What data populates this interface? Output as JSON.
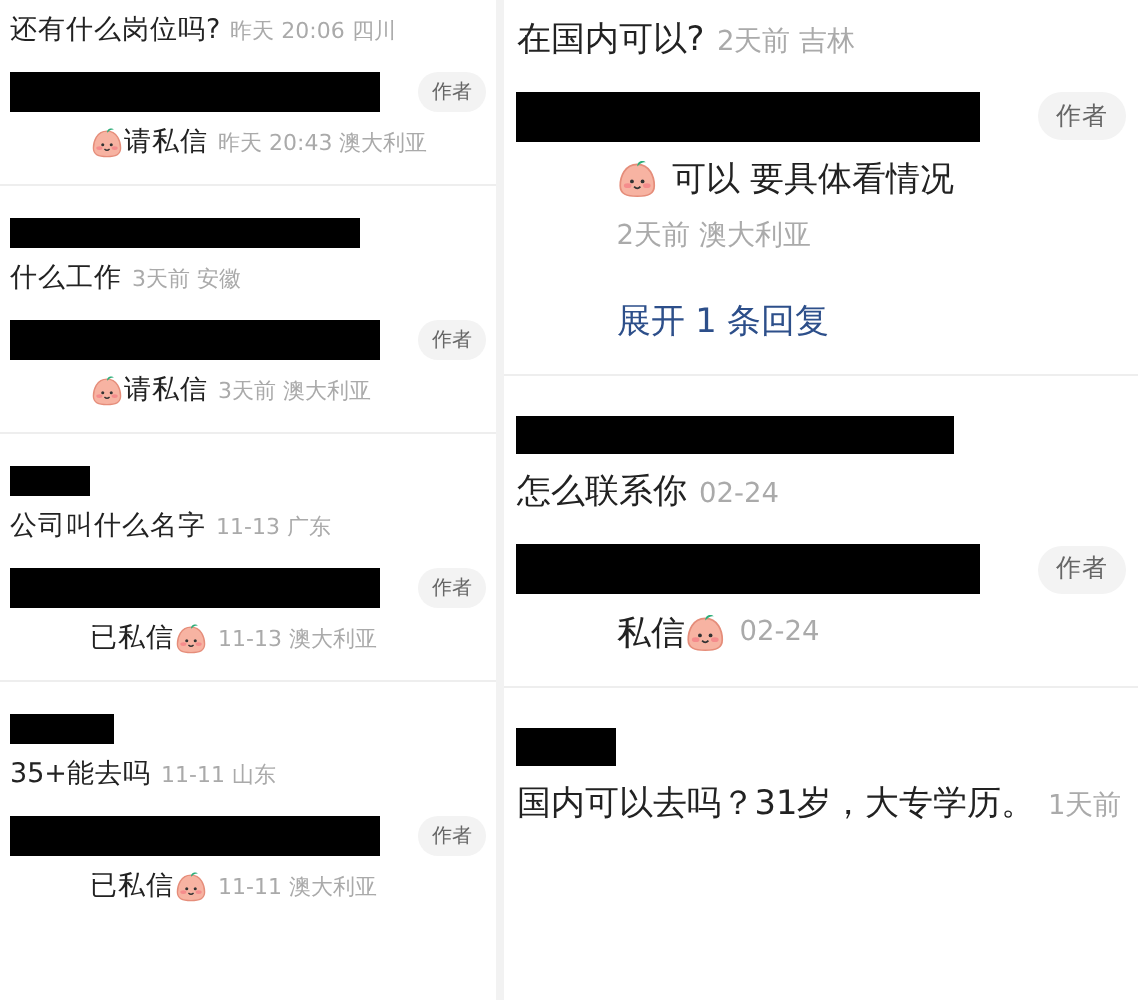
{
  "left_panel": {
    "threads": [
      {
        "comment": {
          "name_redacted": false,
          "text": "还有什么岗位吗?",
          "meta": "昨天 20:06 四川"
        },
        "reply": {
          "badge": "作者",
          "lines": [
            [
              {
                "kind": "emoji"
              },
              {
                "kind": "text",
                "text": "请私信"
              },
              {
                "kind": "meta",
                "text": "昨天 20:43 澳大利亚"
              }
            ]
          ]
        }
      },
      {
        "comment": {
          "name_redacted": true,
          "text": "什么工作",
          "meta": "3天前 安徽"
        },
        "reply": {
          "badge": "作者",
          "lines": [
            [
              {
                "kind": "emoji"
              },
              {
                "kind": "text",
                "text": "请私信"
              },
              {
                "kind": "meta",
                "text": "3天前 澳大利亚"
              }
            ]
          ]
        }
      },
      {
        "comment": {
          "name_redacted": true,
          "text": "公司叫什么名字",
          "meta": "11-13 广东"
        },
        "reply": {
          "badge": "作者",
          "lines": [
            [
              {
                "kind": "text",
                "text": "已私信"
              },
              {
                "kind": "emoji"
              },
              {
                "kind": "meta",
                "text": "11-13 澳大利亚"
              }
            ]
          ]
        }
      },
      {
        "comment": {
          "name_redacted": true,
          "text": "35+能去吗",
          "meta": "11-11 山东"
        },
        "reply": {
          "badge": "作者",
          "lines": [
            [
              {
                "kind": "text",
                "text": "已私信"
              },
              {
                "kind": "emoji"
              },
              {
                "kind": "meta",
                "text": "11-11 澳大利亚"
              }
            ]
          ]
        }
      }
    ]
  },
  "right_panel": {
    "threads": [
      {
        "comment": {
          "name_redacted": false,
          "text": "在国内可以?",
          "meta": "2天前 吉林"
        },
        "reply": {
          "badge": "作者",
          "lines": [
            [
              {
                "kind": "emoji"
              },
              {
                "kind": "text",
                "text": "可以 要具体看情况"
              }
            ],
            [
              {
                "kind": "meta",
                "text": "2天前 澳大利亚"
              }
            ]
          ],
          "link": "展开 1 条回复"
        }
      },
      {
        "comment": {
          "name_redacted": true,
          "text": "怎么联系你",
          "meta": "02-24"
        },
        "reply": {
          "badge": "作者",
          "lines": [
            [
              {
                "kind": "text",
                "text": "私信"
              },
              {
                "kind": "emoji"
              },
              {
                "kind": "meta",
                "text": "02-24"
              }
            ]
          ]
        }
      },
      {
        "comment": {
          "name_redacted": true,
          "text": "国内可以去吗？31岁，大专学历。",
          "meta": "1天前"
        }
      }
    ]
  }
}
